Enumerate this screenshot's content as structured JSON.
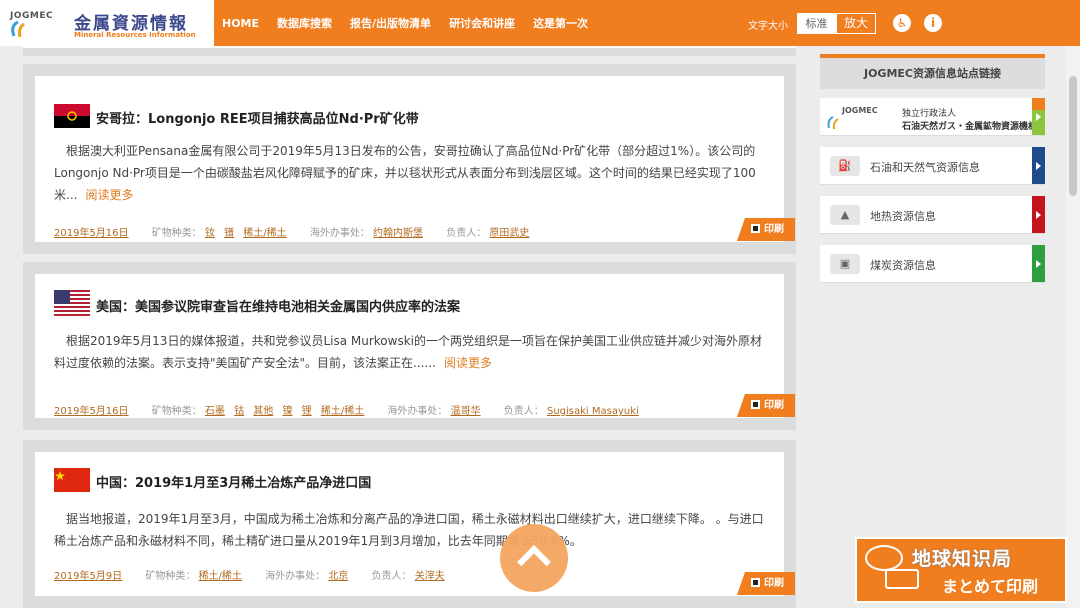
{
  "header": {
    "logo_jogmec": "JOGMEC",
    "logo_cn": "金属資源情報",
    "logo_en": "Mineral Resources Information",
    "nav": [
      "HOME",
      "数据库搜索",
      "报告/出版物清单",
      "研讨会和讲座",
      "这是第一次"
    ],
    "font_size_label": "文字大小",
    "font_normal": "标准",
    "font_large": "放大",
    "accessibility_icon": "accessibility-icon",
    "info_icon": "info-icon"
  },
  "articles": [
    {
      "flag": "angola",
      "title": "安哥拉：Longonjo REE项目捕获高品位Nd·Pr矿化带",
      "body": "根据澳大利亚Pensana金属有限公司于2019年5月13日发布的公告，安哥拉确认了高品位Nd·Pr矿化带（部分超过1%）。该公司的Longonjo Nd·Pr项目是一个由碳酸盐岩风化障碍赋予的矿床，并以毯状形式从表面分布到浅层区域。这个时间的结果已经实现了100米...",
      "readmore": "阅读更多",
      "date": "2019年5月16日",
      "mineral_label": "矿物种类：",
      "minerals": [
        "钕",
        "镨",
        "稀土/稀土"
      ],
      "office_label": "海外办事处：",
      "office": "约翰内斯堡",
      "person_label": "负责人：",
      "person": "原田武史",
      "print": "印刷"
    },
    {
      "flag": "usa",
      "title": "美国：美国参议院审查旨在维持电池相关金属国内供应率的法案",
      "body": "根据2019年5月13日的媒体报道，共和党参议员Lisa Murkowski的一个两党组织是一项旨在保护美国工业供应链并减少对海外原材料过度依赖的法案。表示支持\"美国矿产安全法\"。目前，该法案正在......",
      "readmore": "阅读更多",
      "date": "2019年5月16日",
      "mineral_label": "矿物种类：",
      "minerals": [
        "石墨",
        "钴",
        "其他",
        "镍",
        "锂",
        "稀土/稀土"
      ],
      "office_label": "海外办事处：",
      "office": "温哥华",
      "person_label": "负责人：",
      "person": "Sugisaki Masayuki",
      "print": "印刷"
    },
    {
      "flag": "china",
      "title": "中国：2019年1月至3月稀土冶炼产品净进口国",
      "body": "据当地报道，2019年1月至3月，中国成为稀土冶炼和分离产品的净进口国，稀土永磁材料出口继续扩大，进口继续下降。 。与进口稀土冶炼产品和永磁材料不同，稀土精矿进口量从2019年1月到3月增加，比去年同期增长50.8%。",
      "readmore": "",
      "date": "2019年5月9日",
      "mineral_label": "矿物种类：",
      "minerals": [
        "稀土/稀土"
      ],
      "office_label": "海外办事处：",
      "office": "北京",
      "person_label": "负责人：",
      "person": "关滓夫",
      "print": "印刷"
    }
  ],
  "sidebar": {
    "title": "JOGMEC资源信息站点链接",
    "items": [
      {
        "jog1": "JOGMEC",
        "jog2": "独立行政法人",
        "jog3": "石油天然ガス・金属鉱物資源機構",
        "tab_color": "#8cc63f"
      },
      {
        "label": "石油和天然气资源信息",
        "icon": "oil-gas-icon",
        "tab_color": "#1f4b8c"
      },
      {
        "label": "地热资源信息",
        "icon": "geothermal-icon",
        "tab_color": "#c4161c"
      },
      {
        "label": "煤炭资源信息",
        "icon": "coal-icon",
        "tab_color": "#2e9e3e"
      }
    ]
  },
  "floating": {
    "print_all_cn": "地球知识局",
    "print_all_jp": "まとめて印刷"
  }
}
